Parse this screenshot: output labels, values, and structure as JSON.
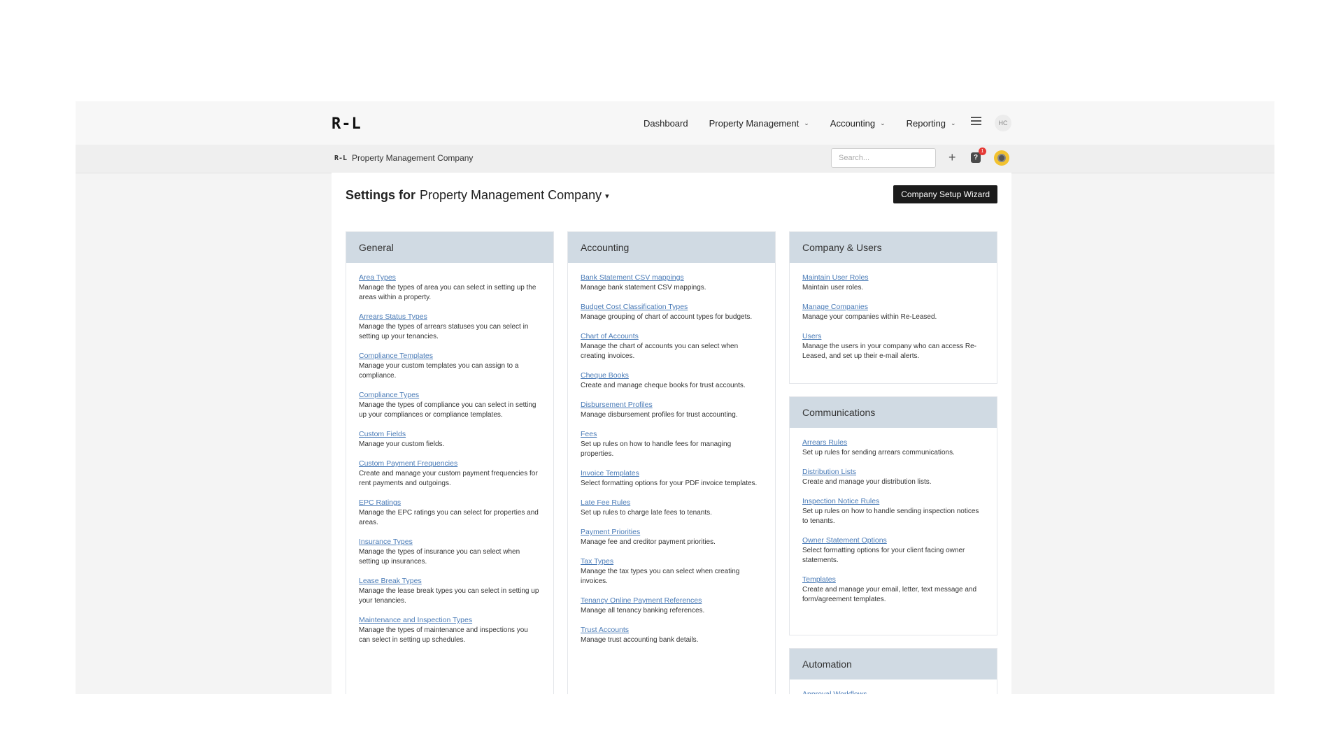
{
  "header": {
    "logo": "R-L",
    "nav": [
      {
        "label": "Dashboard",
        "dropdown": false
      },
      {
        "label": "Property Management",
        "dropdown": true
      },
      {
        "label": "Accounting",
        "dropdown": true
      },
      {
        "label": "Reporting",
        "dropdown": true
      }
    ],
    "user_initials": "HC"
  },
  "subbar": {
    "company_logo": "R-L",
    "company_name": "Property Management Company",
    "search_placeholder": "Search...",
    "notification_count": "1",
    "help_label": "?"
  },
  "page": {
    "title_prefix": "Settings for",
    "company": "Property Management Company",
    "wizard_button": "Company Setup Wizard"
  },
  "cards": {
    "general": {
      "title": "General",
      "items": [
        {
          "link": "Area Types",
          "desc": "Manage the types of area you can select in setting up the areas within a property."
        },
        {
          "link": "Arrears Status Types",
          "desc": "Manage the types of arrears statuses you can select in setting up your tenancies."
        },
        {
          "link": "Compliance Templates",
          "desc": "Manage your custom templates you can assign to a compliance."
        },
        {
          "link": "Compliance Types",
          "desc": "Manage the types of compliance you can select in setting up your compliances or compliance templates."
        },
        {
          "link": "Custom Fields",
          "desc": "Manage your custom fields."
        },
        {
          "link": "Custom Payment Frequencies",
          "desc": "Create and manage your custom payment frequencies for rent payments and outgoings."
        },
        {
          "link": "EPC Ratings",
          "desc": "Manage the EPC ratings you can select for properties and areas."
        },
        {
          "link": "Insurance Types",
          "desc": "Manage the types of insurance you can select when setting up insurances."
        },
        {
          "link": "Lease Break Types",
          "desc": "Manage the lease break types you can select in setting up your tenancies."
        },
        {
          "link": "Maintenance and Inspection Types",
          "desc": "Manage the types of maintenance and inspections you can select in setting up schedules."
        }
      ]
    },
    "accounting": {
      "title": "Accounting",
      "items": [
        {
          "link": "Bank Statement CSV mappings",
          "desc": "Manage bank statement CSV mappings."
        },
        {
          "link": "Budget Cost Classification Types",
          "desc": "Manage grouping of chart of account types for budgets."
        },
        {
          "link": "Chart of Accounts",
          "desc": "Manage the chart of accounts you can select when creating invoices."
        },
        {
          "link": "Cheque Books",
          "desc": "Create and manage cheque books for trust accounts."
        },
        {
          "link": "Disbursement Profiles",
          "desc": "Manage disbursement profiles for trust accounting."
        },
        {
          "link": "Fees",
          "desc": "Set up rules on how to handle fees for managing properties."
        },
        {
          "link": "Invoice Templates",
          "desc": "Select formatting options for your PDF invoice templates."
        },
        {
          "link": "Late Fee Rules",
          "desc": "Set up rules to charge late fees to tenants."
        },
        {
          "link": "Payment Priorities",
          "desc": "Manage fee and creditor payment priorities."
        },
        {
          "link": "Tax Types",
          "desc": "Manage the tax types you can select when creating invoices."
        },
        {
          "link": "Tenancy Online Payment References",
          "desc": "Manage all tenancy banking references."
        },
        {
          "link": "Trust Accounts",
          "desc": "Manage trust accounting bank details."
        }
      ]
    },
    "company_users": {
      "title": "Company & Users",
      "items": [
        {
          "link": "Maintain User Roles",
          "desc": "Maintain user roles."
        },
        {
          "link": "Manage Companies",
          "desc": "Manage your companies within Re-Leased."
        },
        {
          "link": "Users",
          "desc": "Manage the users in your company who can access Re-Leased, and set up their e-mail alerts."
        }
      ]
    },
    "communications": {
      "title": "Communications",
      "items": [
        {
          "link": "Arrears Rules",
          "desc": "Set up rules for sending arrears communications."
        },
        {
          "link": "Distribution Lists",
          "desc": "Create and manage your distribution lists."
        },
        {
          "link": "Inspection Notice Rules",
          "desc": "Set up rules on how to handle sending inspection notices to tenants."
        },
        {
          "link": "Owner Statement Options",
          "desc": "Select formatting options for your client facing owner statements."
        },
        {
          "link": "Templates",
          "desc": "Create and manage your email, letter, text message and form/agreement templates."
        }
      ]
    },
    "automation": {
      "title": "Automation",
      "items": [
        {
          "link": "Approval Workflows",
          "desc": ""
        }
      ]
    }
  }
}
